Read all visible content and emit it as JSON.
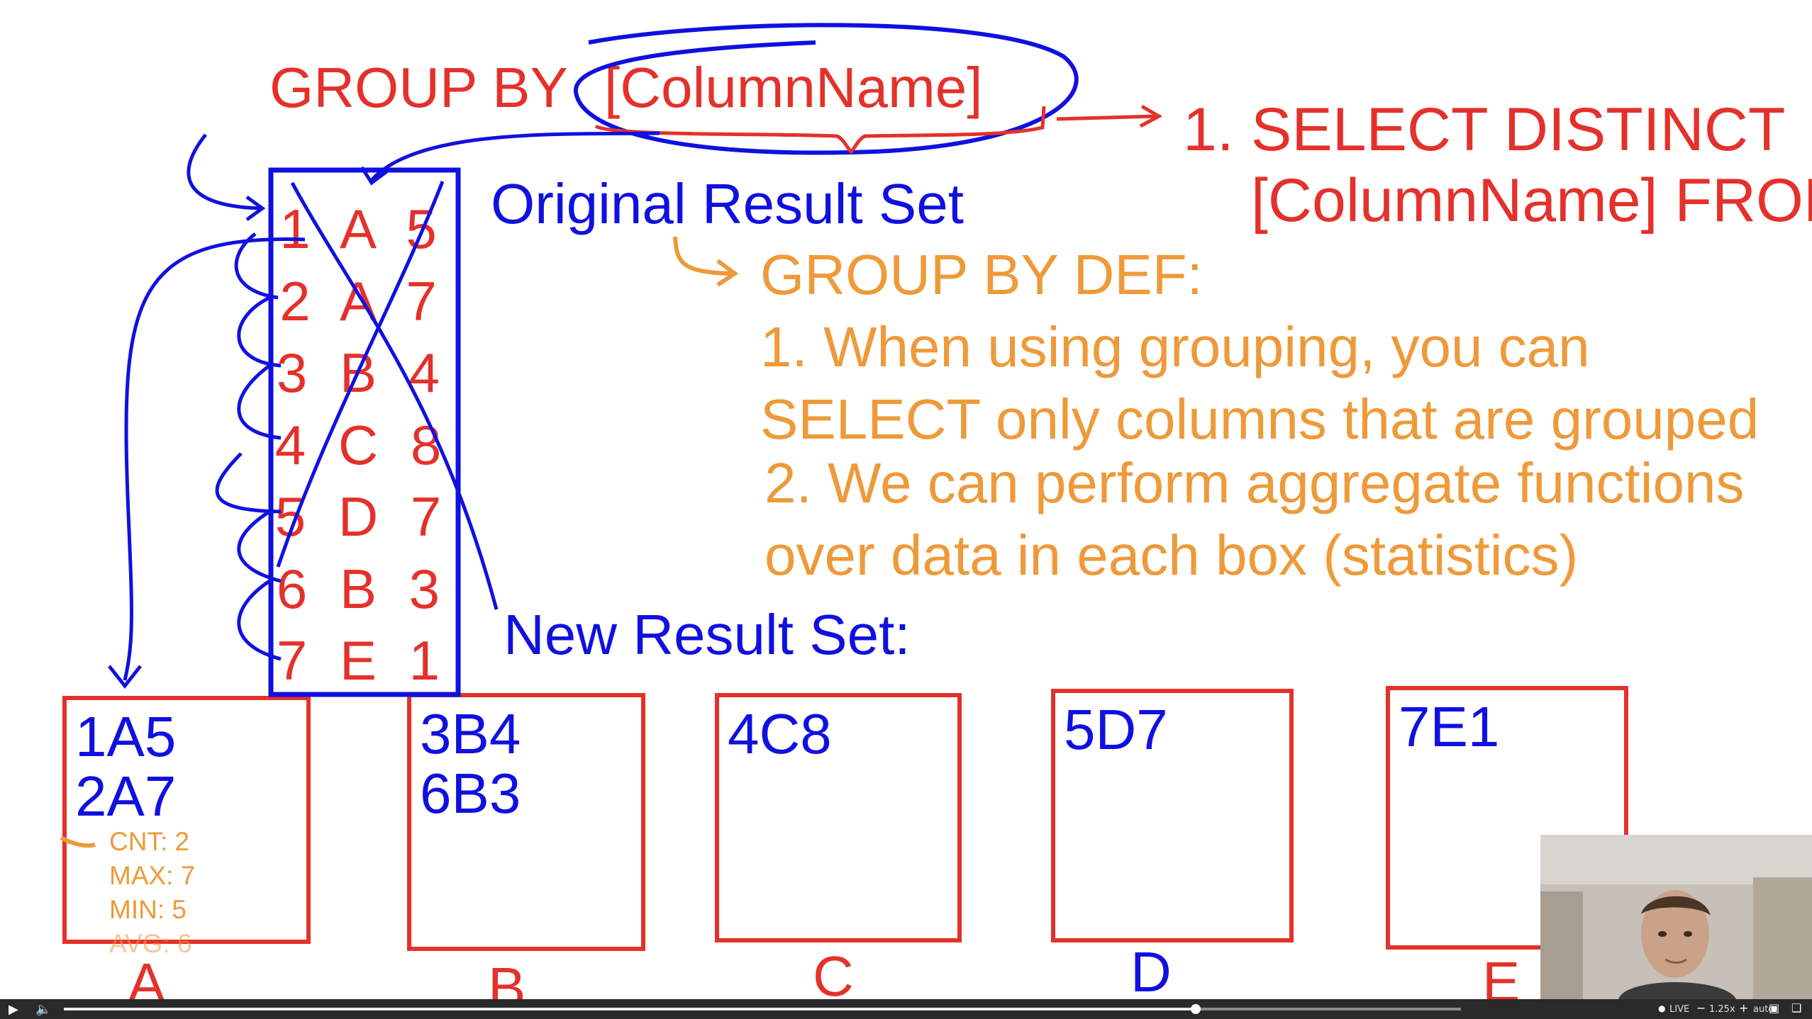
{
  "whiteboard": {
    "group_by_label": "GROUP BY",
    "column_name": "[ColumnName]",
    "step_number": "1.",
    "select_distinct_line1": "SELECT DISTINCT",
    "select_distinct_line2": "[ColumnName] FROM",
    "original_result_set_label": "Original Result Set",
    "new_result_set_label": "New Result Set:",
    "definition": {
      "heading": "GROUP BY DEF:",
      "line1": "1. When using grouping, you can",
      "line2": "SELECT only columns that are grouped",
      "line3": "2. We can perform aggregate functions",
      "line4": "over data in each box (statistics)"
    },
    "original_rows": [
      "1 A 5",
      "2 A 7",
      "3 B 4",
      "4 C 8",
      "5 D 7",
      "6 B 3",
      "7 E 1"
    ],
    "groups": [
      {
        "label": "A",
        "content": "1A5\n2A7",
        "stats": [
          "CNT: 2",
          "MAX: 7",
          "MIN: 5",
          "AVG: 6"
        ]
      },
      {
        "label": "B",
        "content": "3B4\n6B3"
      },
      {
        "label": "C",
        "content": "4C8"
      },
      {
        "label": "D",
        "content": "5D7"
      },
      {
        "label": "E",
        "content": "7E1"
      }
    ],
    "colors": {
      "red": "#e4312b",
      "blue": "#1010e0",
      "orange": "#ee9a3a"
    }
  },
  "player": {
    "play_icon": "play-icon",
    "volume_icon": "volume-icon",
    "live_label": "LIVE",
    "speed_label": "1.25x",
    "quality_label": "auto",
    "progress": 0.81,
    "pip_icon": "picture-in-picture-icon",
    "fullscreen_icon": "fullscreen-icon"
  }
}
